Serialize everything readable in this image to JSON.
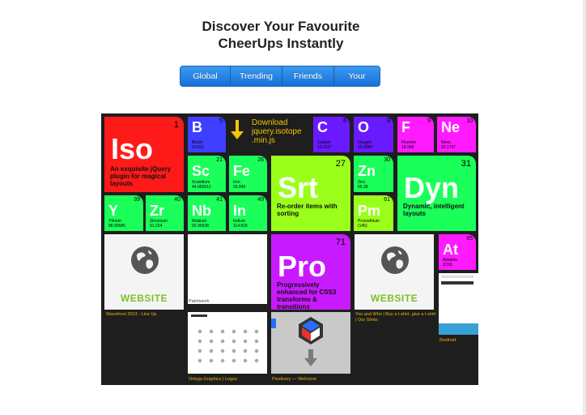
{
  "heading": {
    "line1": "Discover Your Favourite",
    "line2": "CheerUps Instantly"
  },
  "tabs": [
    {
      "label": "Global"
    },
    {
      "label": "Trending"
    },
    {
      "label": "Friends"
    },
    {
      "label": "Your"
    }
  ],
  "download": {
    "text": "Download jquery.isotope .min.js"
  },
  "tiles": {
    "iso": {
      "symbol": "Iso",
      "number": "1",
      "desc": "An exquisite jQuery plugin for magical layouts"
    },
    "b": {
      "symbol": "B",
      "number": "5",
      "name": "Boron",
      "sub": "10.811"
    },
    "c": {
      "symbol": "C",
      "number": "6",
      "name": "Carbon",
      "sub": "12.0107"
    },
    "o": {
      "symbol": "O",
      "number": "8",
      "name": "Oxygen",
      "sub": "15.9994"
    },
    "f": {
      "symbol": "F",
      "number": "9",
      "name": "Fluorine",
      "sub": "18.998"
    },
    "ne": {
      "symbol": "Ne",
      "number": "10",
      "name": "Neon",
      "sub": "20.1797"
    },
    "sc": {
      "symbol": "Sc",
      "number": "21",
      "name": "Scandium",
      "sub": "44.955912"
    },
    "fe": {
      "symbol": "Fe",
      "number": "26",
      "name": "Iron",
      "sub": "55.845"
    },
    "srt": {
      "symbol": "Srt",
      "number": "27",
      "desc": "Re-order items with sorting"
    },
    "zn": {
      "symbol": "Zn",
      "number": "30",
      "name": "Zinc",
      "sub": "65.38"
    },
    "dyn": {
      "symbol": "Dyn",
      "number": "31",
      "desc": "Dynamic, intelligent layouts"
    },
    "y": {
      "symbol": "Y",
      "number": "39",
      "name": "Yttrium",
      "sub": "88.90585"
    },
    "zr": {
      "symbol": "Zr",
      "number": "40",
      "name": "Zirconium",
      "sub": "91.224"
    },
    "nb": {
      "symbol": "Nb",
      "number": "41",
      "name": "Niobium",
      "sub": "92.90638"
    },
    "in": {
      "symbol": "In",
      "number": "49",
      "name": "Indium",
      "sub": "114.818"
    },
    "pm": {
      "symbol": "Pm",
      "number": "61",
      "name": "Promethium",
      "sub": "(145)"
    },
    "pro": {
      "symbol": "Pro",
      "number": "71",
      "desc": "Progressively enhanced for CSS3 transforms & transitions"
    },
    "at": {
      "symbol": "At",
      "number": "85",
      "name": "Astatine",
      "sub": "(210)"
    }
  },
  "cards": {
    "website1": {
      "label": "WEBSITE",
      "caption": "Wavefront 2013 - Line Up"
    },
    "patchwork": {
      "caption": "Patchwork"
    },
    "website2": {
      "label": "WEBSITE",
      "caption": "You and Who | Buy a t-shirt, give a t-shirt | Our Shirts"
    },
    "ortega": {
      "caption": "Ortega Graphics | Logos"
    },
    "pixelivery": {
      "caption": "Pixelivery — Welcome"
    },
    "biodroid": {
      "caption": "Biodroid"
    }
  },
  "colors": {
    "red": "#ff1a1a",
    "blue": "#3f3fff",
    "purple": "#6a1aff",
    "magenta": "#ff1aff",
    "green": "#1aff5a",
    "lime": "#9aff1a",
    "violet": "#c81aff"
  }
}
